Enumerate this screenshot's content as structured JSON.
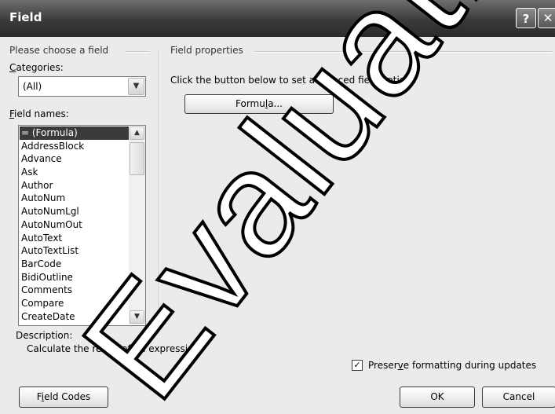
{
  "window": {
    "title": "Field",
    "help_label": "?",
    "close_label": "✕"
  },
  "left": {
    "group_label": "Please choose a field",
    "categories_label_underlined": "C",
    "categories_label_rest": "ategories:",
    "categories_value": "(All)",
    "field_names_label_underlined": "F",
    "field_names_label_rest": "ield names:",
    "field_names": [
      "= (Formula)",
      "AddressBlock",
      "Advance",
      "Ask",
      "Author",
      "AutoNum",
      "AutoNumLgl",
      "AutoNumOut",
      "AutoText",
      "AutoTextList",
      "BarCode",
      "BidiOutline",
      "Comments",
      "Compare",
      "CreateDate"
    ],
    "selected_index": 0
  },
  "right": {
    "group_label": "Field properties",
    "instruction": "Click the button below to set advanced field options",
    "formula_btn_pre": "Formu",
    "formula_btn_u": "l",
    "formula_btn_post": "a..."
  },
  "description": {
    "label": "Description:",
    "text": "Calculate the result of an expression"
  },
  "footer": {
    "preserve_pre": "Preser",
    "preserve_u": "v",
    "preserve_post": "e formatting during updates",
    "preserve_checked": true,
    "field_codes_pre": "F",
    "field_codes_u": "i",
    "field_codes_post": "eld Codes",
    "ok": "OK",
    "cancel": "Cancel"
  },
  "watermark": {
    "text": "Evaluation Copy"
  }
}
